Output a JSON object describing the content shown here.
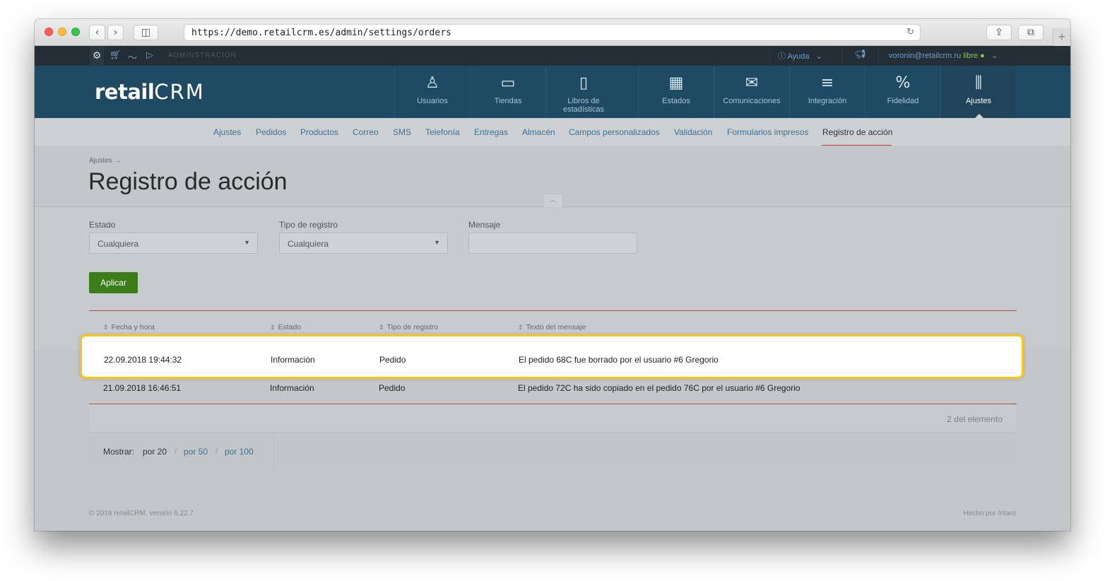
{
  "browser": {
    "url": "https://demo.retailcrm.es/admin/settings/orders"
  },
  "adminbar": {
    "section": "ADMINSTRACIÓN",
    "help": "Ayuda",
    "user_email": "voronin@retailcrm.ru",
    "user_plan": "libre"
  },
  "header": {
    "logo_text": "retail",
    "logo_crm": "CRM",
    "nav": [
      {
        "label": "Usuarios",
        "icon": "user-icon"
      },
      {
        "label": "Tiendas",
        "icon": "store-icon"
      },
      {
        "label": "Libros de estadísticas",
        "icon": "book-icon"
      },
      {
        "label": "Estados",
        "icon": "grid-icon"
      },
      {
        "label": "Comunicaciones",
        "icon": "mail-icon"
      },
      {
        "label": "Integración",
        "icon": "lines-icon"
      },
      {
        "label": "Fidelidad",
        "icon": "percent-tag-icon"
      },
      {
        "label": "Ajustes",
        "icon": "sliders-icon"
      }
    ]
  },
  "subnav": [
    "Ajustes",
    "Pedidos",
    "Productos",
    "Correo",
    "SMS",
    "Telefonía",
    "Entregas",
    "Almacén",
    "Campos personalizados",
    "Validación",
    "Formularios impresos",
    "Registro de acción"
  ],
  "page": {
    "breadcrumb": "Ajustes →",
    "title": "Registro de acción"
  },
  "filters": {
    "estado_label": "Estado",
    "estado_value": "Cualquiera",
    "tipo_label": "Tipo de registro",
    "tipo_value": "Cualquiera",
    "mensaje_label": "Mensaje",
    "apply": "Aplicar"
  },
  "table": {
    "columns": [
      "Fecha y hora",
      "Estado",
      "Tipo de registro",
      "Texto del mensaje"
    ],
    "rows": [
      [
        "22.09.2018 19:44:32",
        "Información",
        "Pedido",
        "El pedido 68C fue borrado por el usuario #6 Gregorio"
      ],
      [
        "21.09.2018 16:46:51",
        "Información",
        "Pedido",
        "El pedido 72C ha sido copiado en el pedido 76C por el usuario #6 Gregorio"
      ]
    ],
    "count": "2 del elemento"
  },
  "pager": {
    "label": "Mostrar:",
    "options": [
      "por 20",
      "por 50",
      "por 100"
    ]
  },
  "footer": {
    "left": "© 2018 retailCRM, versión 6.22.7",
    "right": "Hecho por Intaro"
  },
  "colors": {
    "header_bg": "#1f4a63",
    "highlight": "#f5c518",
    "apply_button": "#3a7d19"
  }
}
